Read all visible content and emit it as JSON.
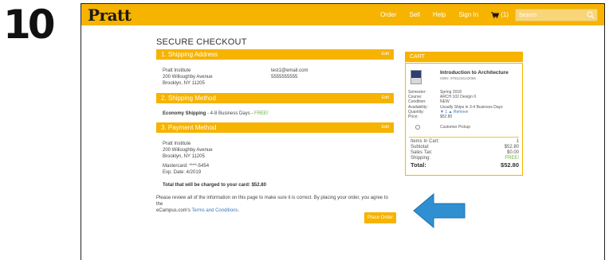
{
  "step_number": "10",
  "header": {
    "logo": "Pratt",
    "nav": [
      "Order",
      "Sell",
      "Help",
      "Sign In"
    ],
    "cart_count": "(1)",
    "search_placeholder": "Search"
  },
  "page_title": "SECURE CHECKOUT",
  "shipping_address": {
    "heading": "1. Shipping Address",
    "edit": "Edit",
    "name": "Pratt Institute",
    "street": "200 Willoughby Avenue",
    "city": "Brooklyn, NY 11205",
    "email": "test1@email.com",
    "phone": "5555555555"
  },
  "shipping_method": {
    "heading": "2. Shipping Method",
    "edit": "Edit",
    "method": "Economy Shipping",
    "detail": " - 4-8 Business Days - ",
    "price": "FREE!"
  },
  "payment_method": {
    "heading": "3. Payment Method",
    "edit": "Edit",
    "name": "Pratt Institute",
    "street": "200 Willoughby Avenue",
    "city": "Brooklyn, NY 11205",
    "card": "Mastercard: ****-5454",
    "exp": "Exp. Date: 4/2019",
    "total_text": "Total that will be charged to your card: $52.80"
  },
  "review_text": "Please review all of the information on this page to make sure it is correct. By placing your order, you agree to the",
  "review_text2": "eCampus.com's ",
  "terms_link": "Terms and Conditions",
  "review_end": ".",
  "place_order": "Place Order",
  "cart": {
    "heading": "CART",
    "product_title": "Introduction to Architecture",
    "isbn": "ISBN: 9781118142066",
    "labels": [
      "Semester:",
      "Course:",
      "Condition:",
      "Availability:",
      "Quantity:",
      "Price:"
    ],
    "values": [
      "Spring 2018",
      "ARCH 102 Design II",
      "NEW",
      "Usually Ships in 3-4 Business Days",
      "▼ 1 ▲ Remove",
      "$52.80"
    ],
    "pickup": "Customer Pickup",
    "items_label": "Items In Cart:",
    "items_value": "1",
    "subtotal_label": "Subtotal:",
    "subtotal_value": "$52.80",
    "tax_label": "Sales Tax:",
    "tax_value": "$0.00",
    "shipping_label": "Shipping:",
    "shipping_value": "FREE!",
    "total_label": "Total:",
    "total_value": "$52.80"
  },
  "colors": {
    "accent": "#f6b300",
    "arrow": "#2f8fd1",
    "free": "#6cae3e"
  }
}
